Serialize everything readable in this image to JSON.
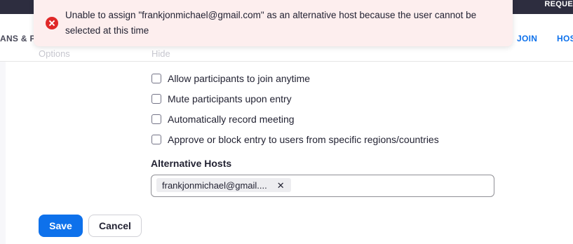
{
  "topbar": {
    "right_text": "REQUE"
  },
  "nav": {
    "left_label": "ANS & PI",
    "join_label": "JOIN",
    "host_label": "HOS"
  },
  "ghost": {
    "options_label": "Options",
    "hide_label": "Hide"
  },
  "toast": {
    "type": "error",
    "icon": "error-x-icon",
    "message": "Unable to assign \"frankjonmichael@gmail.com\" as an alternative host because the user cannot be selected at this time"
  },
  "options": [
    {
      "label": "Allow participants to join anytime",
      "checked": false
    },
    {
      "label": "Mute participants upon entry",
      "checked": false
    },
    {
      "label": "Automatically record meeting",
      "checked": false
    },
    {
      "label": "Approve or block entry to users from specific regions/countries",
      "checked": false
    }
  ],
  "alternative_hosts": {
    "label": "Alternative Hosts",
    "chips": [
      {
        "label": "frankjonmichael@gmail....",
        "remove_icon": "close-icon"
      }
    ]
  },
  "actions": {
    "save_label": "Save",
    "cancel_label": "Cancel"
  },
  "colors": {
    "primary": "#0e71eb",
    "error": "#e02828",
    "toast_bg": "#fdeeee",
    "topbar": "#2d2d3f"
  }
}
